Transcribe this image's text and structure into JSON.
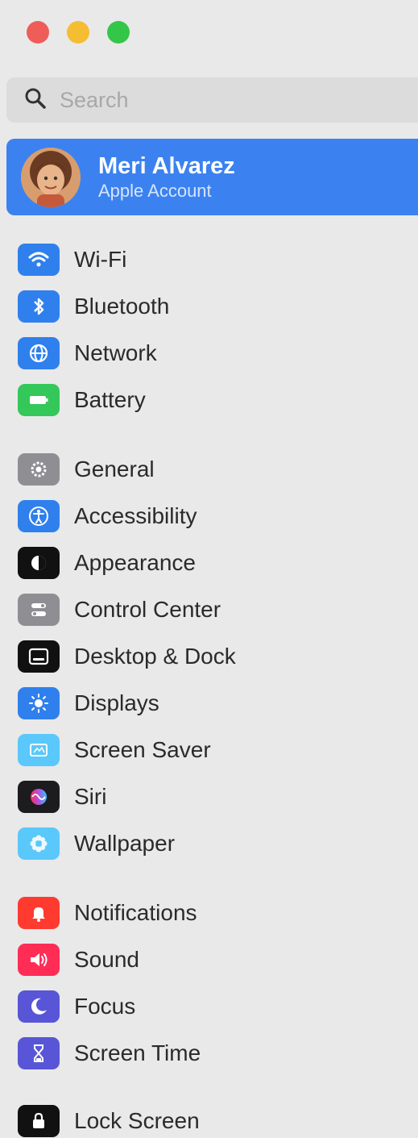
{
  "window": {
    "controls": [
      "close",
      "minimize",
      "zoom"
    ]
  },
  "search": {
    "placeholder": "Search",
    "icon": "magnifying-glass"
  },
  "account": {
    "name": "Meri Alvarez",
    "subtitle": "Apple Account"
  },
  "sidebar": {
    "items": [
      {
        "label": "Wi-Fi",
        "icon": "wifi-icon",
        "color": "#2f80ed"
      },
      {
        "label": "Bluetooth",
        "icon": "bluetooth-icon",
        "color": "#2f80ed"
      },
      {
        "label": "Network",
        "icon": "globe-icon",
        "color": "#2f80ed"
      },
      {
        "label": "Battery",
        "icon": "battery-icon",
        "color": "#34c759"
      },
      {
        "label": "General",
        "icon": "gear-icon",
        "color": "#8e8e93"
      },
      {
        "label": "Accessibility",
        "icon": "accessibility-icon",
        "color": "#2f80ed"
      },
      {
        "label": "Appearance",
        "icon": "appearance-icon",
        "color": "#111111"
      },
      {
        "label": "Control Center",
        "icon": "control-center-icon",
        "color": "#8e8e93"
      },
      {
        "label": "Desktop & Dock",
        "icon": "dock-icon",
        "color": "#111111"
      },
      {
        "label": "Displays",
        "icon": "sun-icon",
        "color": "#2f80ed"
      },
      {
        "label": "Screen Saver",
        "icon": "screen-saver-icon",
        "color": "#5ac8fa"
      },
      {
        "label": "Siri",
        "icon": "siri-icon",
        "color": "#1c1c1e"
      },
      {
        "label": "Wallpaper",
        "icon": "wallpaper-icon",
        "color": "#5ac8fa"
      },
      {
        "label": "Notifications",
        "icon": "bell-icon",
        "color": "#ff3b30"
      },
      {
        "label": "Sound",
        "icon": "speaker-icon",
        "color": "#ff2d55"
      },
      {
        "label": "Focus",
        "icon": "moon-icon",
        "color": "#5856d6"
      },
      {
        "label": "Screen Time",
        "icon": "hourglass-icon",
        "color": "#5856d6"
      },
      {
        "label": "Lock Screen",
        "icon": "lock-icon",
        "color": "#111111"
      }
    ]
  }
}
